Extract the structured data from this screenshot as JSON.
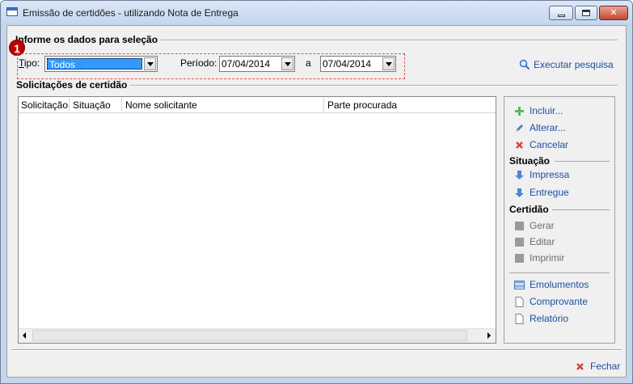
{
  "window": {
    "title": "Emissão de certidões - utilizando Nota de Entrega",
    "minimize_icon": "minimize-icon",
    "maximize_icon": "maximize-icon",
    "close_label": "✕"
  },
  "filter": {
    "section_title": "Informe os dados para seleção",
    "badge": "1",
    "tipo_label": "Tipo:",
    "tipo_value": "Todos",
    "periodo_label": "Período:",
    "periodo_start": "07/04/2014",
    "periodo_sep": "a",
    "periodo_end": "07/04/2014",
    "search_label": "Executar pesquisa"
  },
  "requests": {
    "section_title": "Solicitações de certidão",
    "columns": [
      "Solicitação",
      "Situação",
      "Nome solicitante",
      "Parte procurada"
    ],
    "rows": []
  },
  "actions": {
    "incluir": "Incluir...",
    "alterar": "Alterar...",
    "cancelar": "Cancelar",
    "situacao_title": "Situação",
    "impressa": "Impressa",
    "entregue": "Entregue",
    "certidao_title": "Certidão",
    "gerar": "Gerar",
    "editar": "Editar",
    "imprimir": "Imprimir",
    "emolumentos": "Emolumentos",
    "comprovante": "Comprovante",
    "relatorio": "Relatório"
  },
  "footer": {
    "close_label": "Fechar"
  },
  "colors": {
    "link": "#1a4fa3",
    "selection": "#3399ff",
    "badge": "#c00000"
  }
}
